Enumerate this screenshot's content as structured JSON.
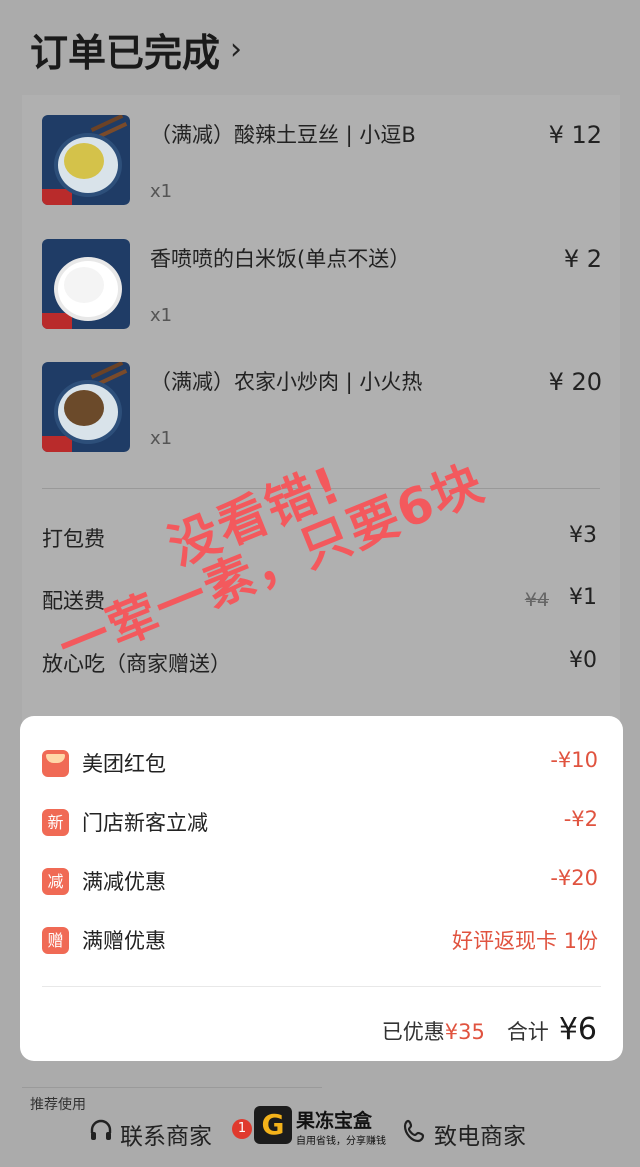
{
  "header": {
    "title": "订单已完成",
    "chevron": "›"
  },
  "items": [
    {
      "name": "（满减）酸辣土豆丝 | 小逗B",
      "qty": "x1",
      "price": "¥ 12",
      "thumb_color": "#d4c24a"
    },
    {
      "name": "香喷喷的白米饭(单点不送）",
      "qty": "x1",
      "price": "¥ 2",
      "thumb_color": "#f4f4f4"
    },
    {
      "name": "（满减）农家小炒肉 | 小火热",
      "qty": "x1",
      "price": "¥ 20",
      "thumb_color": "#6b4a2a"
    }
  ],
  "fees": [
    {
      "label": "打包费",
      "value": "¥3",
      "original": ""
    },
    {
      "label": "配送费",
      "value": "¥1",
      "original": "¥4"
    },
    {
      "label": "放心吃（商家赠送）",
      "value": "¥0",
      "original": ""
    }
  ],
  "discounts": [
    {
      "icon": "red-packet-icon",
      "icon_text": "",
      "label": "美团红包",
      "value": "-¥10"
    },
    {
      "icon": "new-customer-icon",
      "icon_text": "新",
      "label": "门店新客立减",
      "value": "-¥2"
    },
    {
      "icon": "discount-icon",
      "icon_text": "减",
      "label": "满减优惠",
      "value": "-¥20"
    },
    {
      "icon": "gift-icon",
      "icon_text": "赠",
      "label": "满赠优惠",
      "value": "好评返现卡 1份"
    }
  ],
  "summary": {
    "saved_label": "已优惠",
    "saved_amount": "¥35",
    "total_label": "合计",
    "total_amount": "¥6"
  },
  "bottom": {
    "recommend": "推荐使用",
    "contact_merchant": "联系商家",
    "badge": "1",
    "call_merchant": "致电商家",
    "logo_glyph": "G",
    "logo_title": "果冻宝盒",
    "logo_subtitle": "自用省钱，分享赚钱"
  },
  "overlay": {
    "line1": "没看错!",
    "line2": "一荤一素，只要6块"
  },
  "colors": {
    "accent": "#e0533f",
    "overlay": "#f3595d",
    "card_bg": "#ffffff",
    "page_bg": "#ababab"
  }
}
